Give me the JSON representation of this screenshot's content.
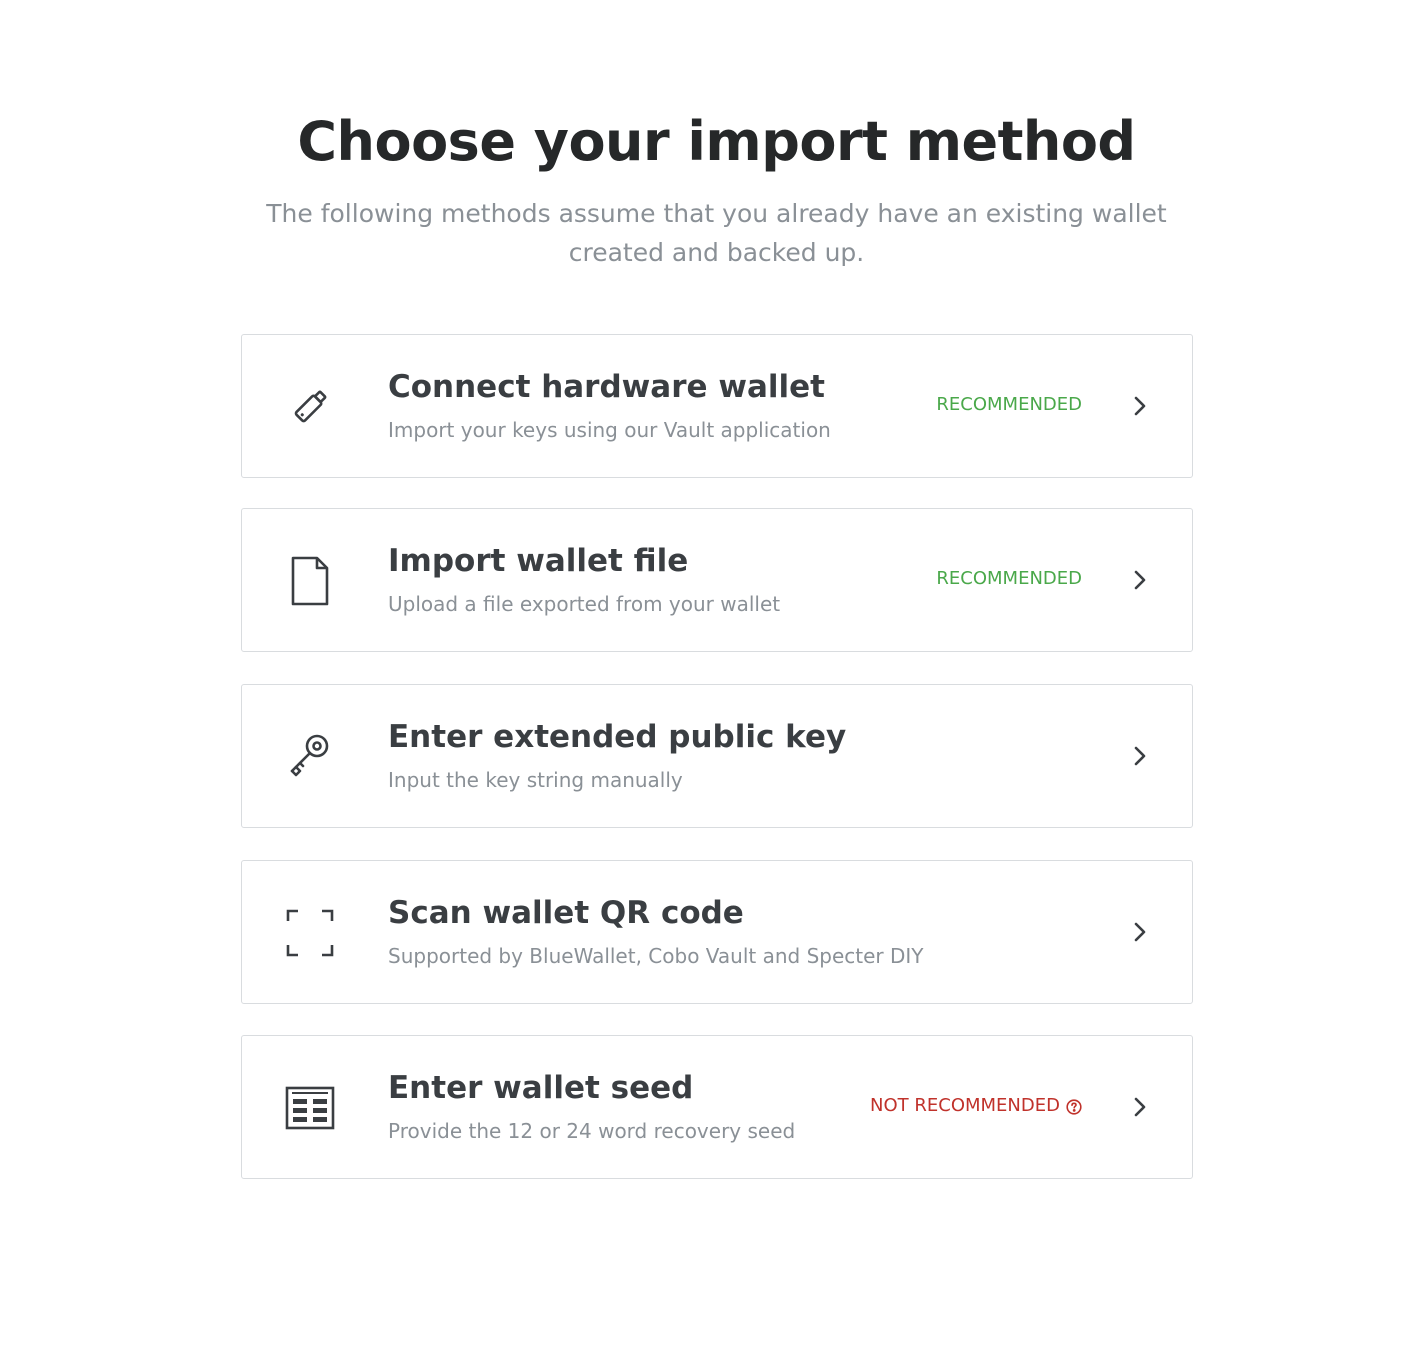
{
  "header": {
    "title": "Choose your import method",
    "subtitle": "The following methods assume that you already have an existing wallet created and backed up."
  },
  "methods": [
    {
      "icon": "usb-drive-icon",
      "title": "Connect hardware wallet",
      "description": "Import your keys using our Vault application",
      "badge": "RECOMMENDED",
      "badge_type": "recommended"
    },
    {
      "icon": "file-icon",
      "title": "Import wallet file",
      "description": "Upload a file exported from your wallet",
      "badge": "RECOMMENDED",
      "badge_type": "recommended"
    },
    {
      "icon": "key-icon",
      "title": "Enter extended public key",
      "description": "Input the key string manually",
      "badge": "",
      "badge_type": "none"
    },
    {
      "icon": "qr-scan-icon",
      "title": "Scan wallet QR code",
      "description": "Supported by BlueWallet, Cobo Vault and Specter DIY",
      "badge": "",
      "badge_type": "none"
    },
    {
      "icon": "seed-list-icon",
      "title": "Enter wallet seed",
      "description": "Provide the 12 or 24 word recovery seed",
      "badge": "NOT RECOMMENDED",
      "badge_type": "not-recommended"
    }
  ],
  "colors": {
    "recommended": "#4aa84a",
    "not_recommended": "#c0322b",
    "border": "#d9dcdf",
    "title_text": "#262829",
    "muted_text": "#8a9096"
  }
}
